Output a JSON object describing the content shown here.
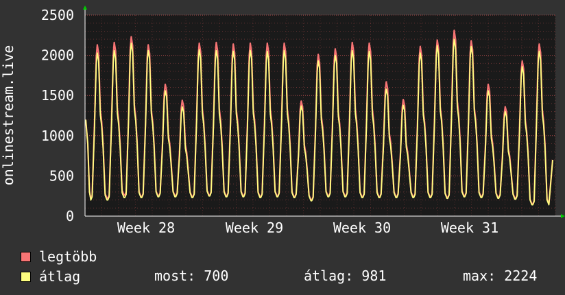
{
  "chart_data": {
    "type": "line",
    "ylabel": "onlinestream.live",
    "ylim": [
      0,
      2500
    ],
    "yticks": [
      "0",
      "500",
      "1000",
      "1500",
      "2000",
      "2500"
    ],
    "yticks_values": [
      0,
      500,
      1000,
      1500,
      2000,
      2500
    ],
    "xticks": [
      "Week 28",
      "Week 29",
      "Week 30",
      "Week 31"
    ],
    "grid": true,
    "colors": {
      "background": "#323232",
      "plot_background": "#1a1a1a",
      "grid": "#c05050",
      "max_series": "#f87575",
      "avg_series": "#ffff80",
      "axis_arrow": "#00cc00"
    },
    "series": [
      {
        "name": "legtöbb",
        "color": "#f87575",
        "peaks": [
          2130,
          2160,
          2230,
          2130,
          1640,
          1440,
          2150,
          2160,
          2140,
          2150,
          2150,
          2150,
          1430,
          2010,
          2080,
          2160,
          2150,
          1670,
          1450,
          2110,
          2190,
          2310,
          2180,
          1640,
          1360,
          1930,
          2140
        ],
        "troughs": [
          220,
          260,
          240,
          250,
          250,
          240,
          260,
          250,
          250,
          240,
          250,
          240,
          200,
          250,
          250,
          240,
          240,
          240,
          240,
          240,
          230,
          250,
          240,
          230,
          220,
          150
        ]
      },
      {
        "name": "átlag",
        "color": "#ffff80",
        "peaks": [
          2030,
          2060,
          2150,
          2060,
          1560,
          1360,
          2070,
          2060,
          2050,
          2060,
          2050,
          2060,
          1370,
          1930,
          2000,
          2060,
          2050,
          1580,
          1380,
          2030,
          2120,
          2200,
          2110,
          1560,
          1300,
          1860,
          2050
        ],
        "troughs": [
          200,
          230,
          230,
          240,
          240,
          230,
          250,
          240,
          240,
          230,
          240,
          230,
          190,
          240,
          240,
          230,
          230,
          230,
          230,
          230,
          220,
          240,
          230,
          220,
          210,
          140
        ]
      }
    ],
    "stats": {
      "most": "700",
      "atlag": "981",
      "max": "2224"
    }
  },
  "legend": {
    "max_label": "legtöbb",
    "avg_label": "átlag",
    "most_text": "most: 700",
    "atlag_text": "átlag: 981",
    "max_text": "max: 2224"
  }
}
